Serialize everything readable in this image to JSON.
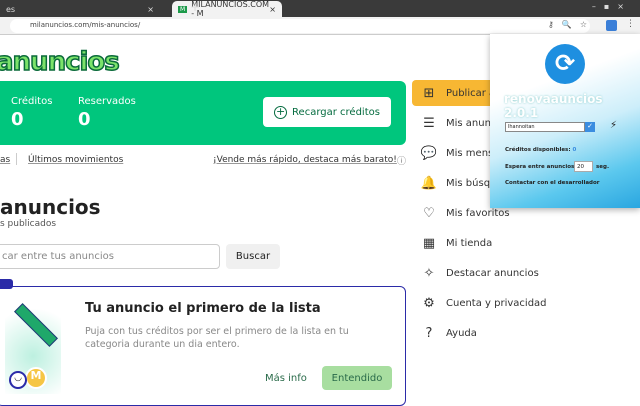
{
  "browser": {
    "tab_inactive": "es",
    "tab_active": "MILANUNCIOS.COM - M",
    "url": "milanuncios.com/mis-anuncios/"
  },
  "logo": "anuncios",
  "credits": {
    "creditos_label": "Créditos",
    "creditos_value": "0",
    "reservados_label": "Reservados",
    "reservados_value": "0",
    "recargar": "Recargar créditos"
  },
  "links": {
    "left": "as",
    "movimientos": "Últimos movimientos",
    "promo": "¡Vende más rápido, destaca más barato!"
  },
  "heading": {
    "title": "anuncios",
    "subtitle": "s publicados"
  },
  "search": {
    "placeholder": "car entre tus anuncios",
    "button": "Buscar"
  },
  "promo": {
    "title": "Tu anuncio el primero de la lista",
    "text": "Puja con tus créditos por ser el primero de la lista en tu categoria durante un dia entero.",
    "more": "Más info",
    "ok": "Entendido"
  },
  "sidebar": [
    {
      "icon": "plus-square-icon",
      "glyph": "⊞",
      "label": "Publicar anuncio"
    },
    {
      "icon": "list-icon",
      "glyph": "☰",
      "label": "Mis anuncios"
    },
    {
      "icon": "chat-icon",
      "glyph": "💬",
      "label": "Mis mensajes"
    },
    {
      "icon": "bell-icon",
      "glyph": "🔔",
      "label": "Mis búsquedas"
    },
    {
      "icon": "heart-icon",
      "glyph": "♡",
      "label": "Mis favoritos"
    },
    {
      "icon": "store-icon",
      "glyph": "▦",
      "label": "Mi tienda"
    },
    {
      "icon": "sparkle-icon",
      "glyph": "✧",
      "label": "Destacar anuncios"
    },
    {
      "icon": "account-icon",
      "glyph": "⚙",
      "label": "Cuenta y privacidad"
    },
    {
      "icon": "help-icon",
      "glyph": "?",
      "label": "Ayuda"
    }
  ],
  "extension": {
    "name": "renovaauncios",
    "version": "2.0.1",
    "user": "lhannoitan",
    "creditos": "Créditos disponibles:",
    "creditos_value": "0",
    "espera": "Espera entre anuncios:",
    "espera_value": "20",
    "seg": "seg.",
    "contact": "Contactar con el desarrollador"
  },
  "colors": {
    "green": "#00c67d",
    "accent_orange": "#f7b733",
    "blue": "#2b2ba8"
  }
}
